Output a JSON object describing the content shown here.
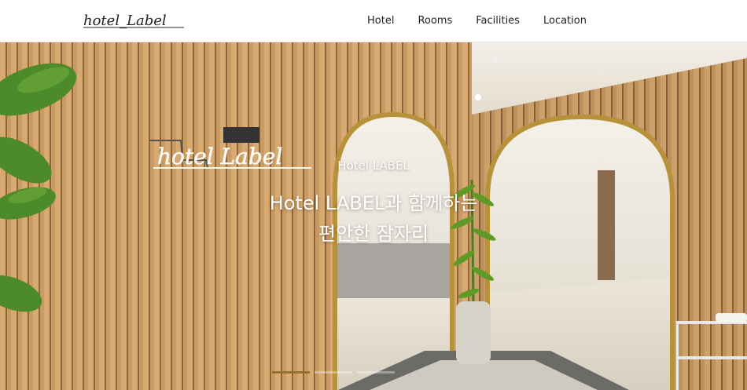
{
  "header": {
    "logo_text": "hotel_Label",
    "nav": [
      {
        "label": "Hotel"
      },
      {
        "label": "Rooms"
      },
      {
        "label": "Facilities"
      },
      {
        "label": "Location"
      }
    ]
  },
  "hero": {
    "subtitle": "Hotel LABEL",
    "title_line1": "Hotel LABEL과 함께하는",
    "title_line2": "편안한 잠자리",
    "sign_text": "hotel Label",
    "slides": 3,
    "active_slide": 1
  },
  "colors": {
    "wood": "#c9955c",
    "gold": "#b8923a",
    "wall": "#f1ece2"
  }
}
